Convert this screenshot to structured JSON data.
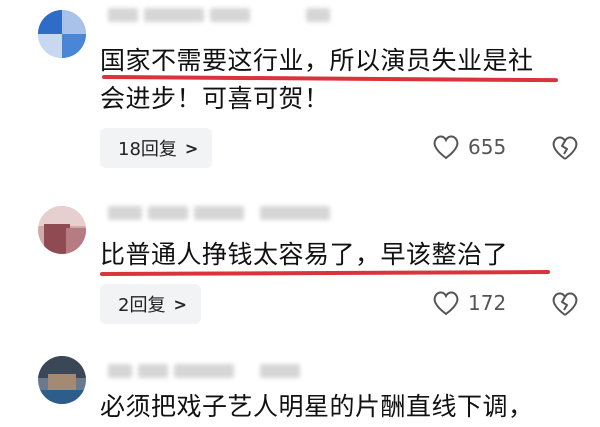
{
  "comments": [
    {
      "text_lines": [
        "国家不需要这行业，所以演员失业是社",
        "会进步！可喜可贺！"
      ],
      "reply_label": "18回复",
      "likes": "655"
    },
    {
      "text_lines": [
        "比普通人挣钱太容易了，早该整治了"
      ],
      "reply_label": "2回复",
      "likes": "172"
    },
    {
      "text_lines": [
        "必须把戏子艺人明星的片酬直线下调，"
      ]
    }
  ],
  "colors": {
    "underline": "#d9343b",
    "reply_bg": "#f2f3f5"
  },
  "icons": {
    "like": "heart-outline-icon",
    "dislike": "broken-heart-icon",
    "reply_chevron": "chevron-right-icon"
  }
}
